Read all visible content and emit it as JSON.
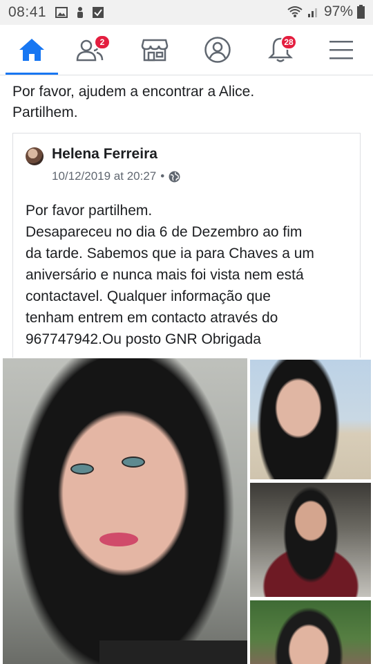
{
  "status_bar": {
    "time": "08:41",
    "battery": "97%",
    "left_icons": [
      "image-icon",
      "person-icon",
      "checkbox-icon"
    ],
    "right_icons": [
      "wifi-icon",
      "signal-icon",
      "battery-icon"
    ]
  },
  "nav": {
    "tabs": [
      {
        "name": "home-icon",
        "active": true
      },
      {
        "name": "friends-icon",
        "badge": "2"
      },
      {
        "name": "marketplace-icon"
      },
      {
        "name": "profile-icon"
      },
      {
        "name": "notifications-icon",
        "badge": "28"
      },
      {
        "name": "menu-icon"
      }
    ],
    "accent": "#1877f2",
    "badge_color": "#e41e3f"
  },
  "post": {
    "text_line1": "Por favor, ajudem a encontrar a Alice.",
    "text_line2": "Partilhem."
  },
  "shared_post": {
    "author": "Helena Ferreira",
    "timestamp": "10/12/2019 at 20:27",
    "separator": "•",
    "privacy_icon": "globe-icon",
    "lines": [
      "Por favor partilhem.",
      "Desapareceu no dia 6 de Dezembro ao fim",
      "da tarde. Sabemos que ia para Chaves a um",
      "aniversário e nunca mais foi vista nem está",
      "contactavel. Qualquer informação que",
      "tenham entrem em contacto através  do",
      "967747942.Ou posto GNR Obrigada"
    ]
  },
  "photos": {
    "count": 4
  }
}
